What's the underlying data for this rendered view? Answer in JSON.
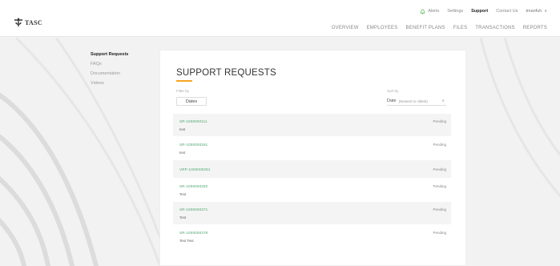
{
  "app": {
    "logo_text": "TASC"
  },
  "util_nav": {
    "alerts": "Alerts",
    "settings": "Settings",
    "support": "Support",
    "contact": "Contact Us",
    "user": "tmanfuh"
  },
  "main_nav": [
    "OVERVIEW",
    "EMPLOYEES",
    "BENEFIT PLANS",
    "FILES",
    "TRANSACTIONS",
    "REPORTS"
  ],
  "sidebar": {
    "items": [
      {
        "label": "Support Requests",
        "active": true
      },
      {
        "label": "FAQs",
        "active": false
      },
      {
        "label": "Documentation",
        "active": false
      },
      {
        "label": "Videos",
        "active": false
      }
    ]
  },
  "page": {
    "title": "SUPPORT REQUESTS",
    "filter_label": "Filter by",
    "filter_button": "Dates",
    "sort_label": "Sort by",
    "sort_value": "Date",
    "sort_option": "(Newest to oldest)"
  },
  "requests": [
    {
      "id": "SR-1000000111",
      "subject": "test",
      "status": "Pending"
    },
    {
      "id": "SR-1000000261",
      "subject": "test",
      "status": "Pending"
    },
    {
      "id": "VRP-1000000281",
      "subject": "",
      "status": "Pending"
    },
    {
      "id": "SR-1000000282",
      "subject": "Test",
      "status": "Pending"
    },
    {
      "id": "SR-1000000371",
      "subject": "Test",
      "status": "Pending"
    },
    {
      "id": "SR-1000000378",
      "subject": "Test Test",
      "status": "Pending"
    }
  ],
  "colors": {
    "accent": "#f5a623",
    "link_green": "#4aa36b",
    "alert_green": "#5cb85c"
  }
}
